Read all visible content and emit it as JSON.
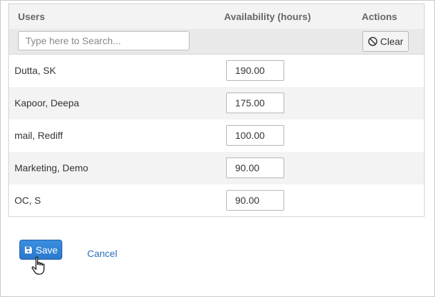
{
  "grid": {
    "columns": {
      "users": "Users",
      "availability": "Availability (hours)",
      "actions": "Actions"
    },
    "search": {
      "placeholder": "Type here to Search...",
      "value": ""
    },
    "clear_label": "Clear",
    "clear_icon": "ban-icon",
    "rows": [
      {
        "name": "Dutta, SK",
        "hours": "190.00"
      },
      {
        "name": "Kapoor, Deepa",
        "hours": "175.00"
      },
      {
        "name": "mail, Rediff",
        "hours": "100.00"
      },
      {
        "name": "Marketing, Demo",
        "hours": "90.00"
      },
      {
        "name": "OC, S",
        "hours": "90.00"
      }
    ]
  },
  "footer": {
    "save_label": "Save",
    "save_icon": "floppy-disk-icon",
    "cancel_label": "Cancel"
  },
  "colors": {
    "primary": "#2f80d6",
    "link": "#2a6ebb",
    "row_alt": "#f3f3f3",
    "header_bg": "#f3f3f3"
  }
}
